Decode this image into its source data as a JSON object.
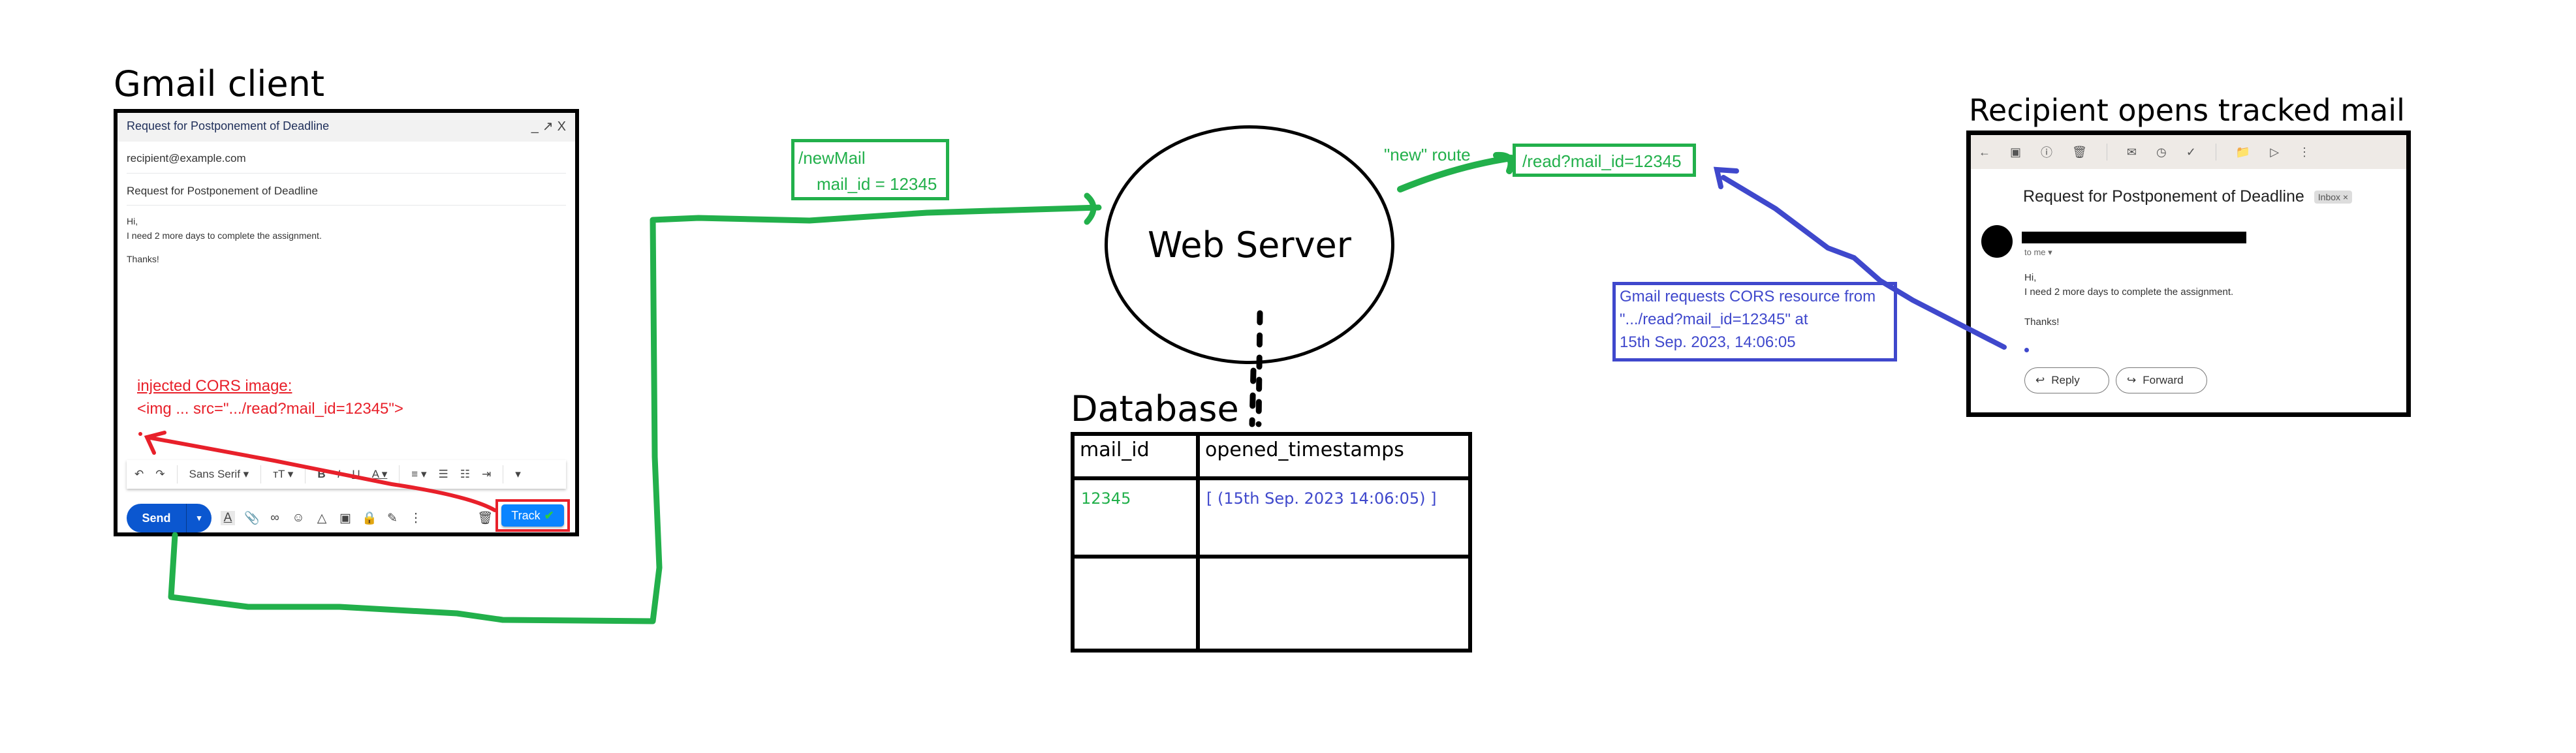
{
  "headings": {
    "gmail_client": "Gmail client",
    "web_server": "Web Server",
    "database": "Database",
    "recipient": "Recipient opens tracked mail"
  },
  "compose": {
    "title": "Request for Postponement of Deadline",
    "window_controls": [
      "minimize-icon",
      "expand-icon",
      "close-icon"
    ],
    "window_controls_glyphs": "_ ↗ X",
    "to": "recipient@example.com",
    "subject": "Request for Postponement of Deadline",
    "body": [
      "Hi,",
      "I need 2 more days to complete the assignment.",
      "",
      "Thanks!"
    ],
    "injected_label": "injected CORS image:",
    "injected_code": "<img  ...  src=\".../read?mail_id=12345\">",
    "format_toolbar": {
      "undo": "↶",
      "redo": "↷",
      "font": "Sans Serif",
      "font_size": "ᴛT",
      "bold": "B",
      "italic": "I",
      "underline": "U",
      "text_color": "A",
      "align": "≡",
      "numbered_list": "☰",
      "bulleted_list": "☷",
      "indent": "⇥",
      "more": "▾"
    },
    "send_label": "Send",
    "send_dropdown": "▾",
    "bottom_icons": [
      "formatting-icon",
      "attach-icon",
      "link-icon",
      "emoji-icon",
      "drive-icon",
      "photo-icon",
      "confidential-icon",
      "signature-icon",
      "more-icon",
      "trash-icon"
    ],
    "track_label": "Track",
    "track_check": "✔"
  },
  "new_mail_box": {
    "line1": "/newMail",
    "line2": "mail_id = 12345"
  },
  "route_label": "\"new\" route",
  "read_box": "/read?mail_id=12345",
  "database_table": {
    "columns": [
      "mail_id",
      "opened_timestamps"
    ],
    "rows": [
      [
        "12345",
        "[ (15th Sep. 2023 14:06:05) ]"
      ],
      [
        "",
        ""
      ]
    ]
  },
  "cors_request_box": {
    "lines": [
      "Gmail requests CORS resource from",
      "\".../read?mail_id=12345\" at",
      "15th Sep. 2023, 14:06:05"
    ]
  },
  "recipient_view": {
    "subject": "Request for Postponement of Deadline",
    "label_chip": "Inbox ×",
    "to_me": "to me ▾",
    "body": [
      "Hi,",
      "I need 2 more days to complete the assignment.",
      "",
      "Thanks!"
    ],
    "reply_label": "Reply",
    "forward_label": "Forward"
  },
  "colors": {
    "green": "#22b04b",
    "red": "#e8202a",
    "blue": "#3f48cc",
    "gmail_send": "#0b57d0",
    "track_button": "#0a84ff"
  }
}
